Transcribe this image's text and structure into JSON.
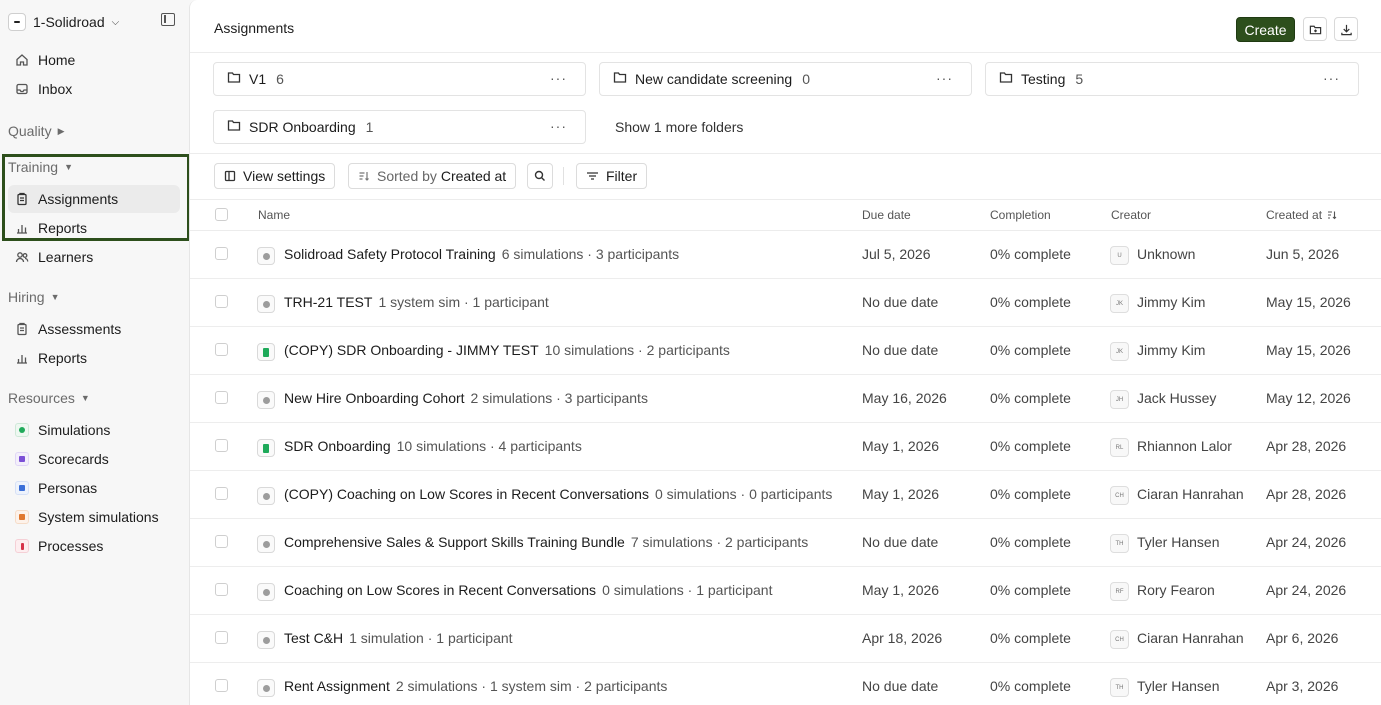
{
  "workspace": {
    "name": "1-Solidroad"
  },
  "nav": {
    "home": "Home",
    "inbox": "Inbox",
    "quality": "Quality",
    "training": "Training",
    "assignments": "Assignments",
    "training_reports": "Reports",
    "learners": "Learners",
    "hiring": "Hiring",
    "assessments": "Assessments",
    "hiring_reports": "Reports",
    "resources": "Resources",
    "simulations": "Simulations",
    "scorecards": "Scorecards",
    "personas": "Personas",
    "system_simulations": "System simulations",
    "processes": "Processes"
  },
  "colors": {
    "accent": "#2d4f1c",
    "simulations": "#1faa5a",
    "scorecards": "#7b4fd6",
    "personas": "#3b6fd8",
    "system_simulations": "#e0782f",
    "processes": "#d6334a"
  },
  "header": {
    "title": "Assignments",
    "create_label": "Create"
  },
  "folders": [
    {
      "name": "V1",
      "count": "6"
    },
    {
      "name": "New candidate screening",
      "count": "0"
    },
    {
      "name": "Testing",
      "count": "5"
    },
    {
      "name": "SDR Onboarding",
      "count": "1"
    }
  ],
  "folders_more": "···",
  "show_more_folders": "Show 1 more folders",
  "toolbar": {
    "view_settings": "View settings",
    "sorted_by_prefix": "Sorted by",
    "sorted_by_value": "Created at",
    "filter": "Filter"
  },
  "columns": {
    "name": "Name",
    "due_date": "Due date",
    "completion": "Completion",
    "creator": "Creator",
    "created_at": "Created at"
  },
  "rows": [
    {
      "name": "Solidroad Safety Protocol Training",
      "meta": "6 simulations · 3 participants",
      "due": "Jul 5, 2026",
      "completion": "0% complete",
      "initials": "U",
      "creator": "Unknown",
      "created": "Jun 5, 2026",
      "icon": "circle"
    },
    {
      "name": "TRH-21 TEST",
      "meta": "1 system sim · 1 participant",
      "due": "No due date",
      "completion": "0% complete",
      "initials": "JK",
      "creator": "Jimmy Kim",
      "created": "May 15, 2026",
      "icon": "circle"
    },
    {
      "name": "(COPY) SDR Onboarding - JIMMY TEST",
      "meta": "10 simulations · 2 participants",
      "due": "No due date",
      "completion": "0% complete",
      "initials": "JK",
      "creator": "Jimmy Kim",
      "created": "May 15, 2026",
      "icon": "green"
    },
    {
      "name": "New Hire Onboarding Cohort",
      "meta": "2 simulations · 3 participants",
      "due": "May 16, 2026",
      "completion": "0% complete",
      "initials": "JH",
      "creator": "Jack Hussey",
      "created": "May 12, 2026",
      "icon": "circle"
    },
    {
      "name": "SDR Onboarding",
      "meta": "10 simulations · 4 participants",
      "due": "May 1, 2026",
      "completion": "0% complete",
      "initials": "RL",
      "creator": "Rhiannon Lalor",
      "created": "Apr 28, 2026",
      "icon": "green"
    },
    {
      "name": "(COPY) Coaching on Low Scores in Recent Conversations",
      "meta": "0 simulations · 0 participants",
      "due": "May 1, 2026",
      "completion": "0% complete",
      "initials": "CH",
      "creator": "Ciaran Hanrahan",
      "created": "Apr 28, 2026",
      "icon": "circle"
    },
    {
      "name": "Comprehensive Sales & Support Skills Training Bundle",
      "meta": "7 simulations · 2 participants",
      "due": "No due date",
      "completion": "0% complete",
      "initials": "TH",
      "creator": "Tyler Hansen",
      "created": "Apr 24, 2026",
      "icon": "circle"
    },
    {
      "name": "Coaching on Low Scores in Recent Conversations",
      "meta": "0 simulations · 1 participant",
      "due": "May 1, 2026",
      "completion": "0% complete",
      "initials": "RF",
      "creator": "Rory Fearon",
      "created": "Apr 24, 2026",
      "icon": "circle"
    },
    {
      "name": "Test C&H",
      "meta": "1 simulation · 1 participant",
      "due": "Apr 18, 2026",
      "completion": "0% complete",
      "initials": "CH",
      "creator": "Ciaran Hanrahan",
      "created": "Apr 6, 2026",
      "icon": "circle"
    },
    {
      "name": "Rent Assignment",
      "meta": "2 simulations · 1 system sim · 2 participants",
      "due": "No due date",
      "completion": "0% complete",
      "initials": "TH",
      "creator": "Tyler Hansen",
      "created": "Apr 3, 2026",
      "icon": "circle"
    }
  ]
}
